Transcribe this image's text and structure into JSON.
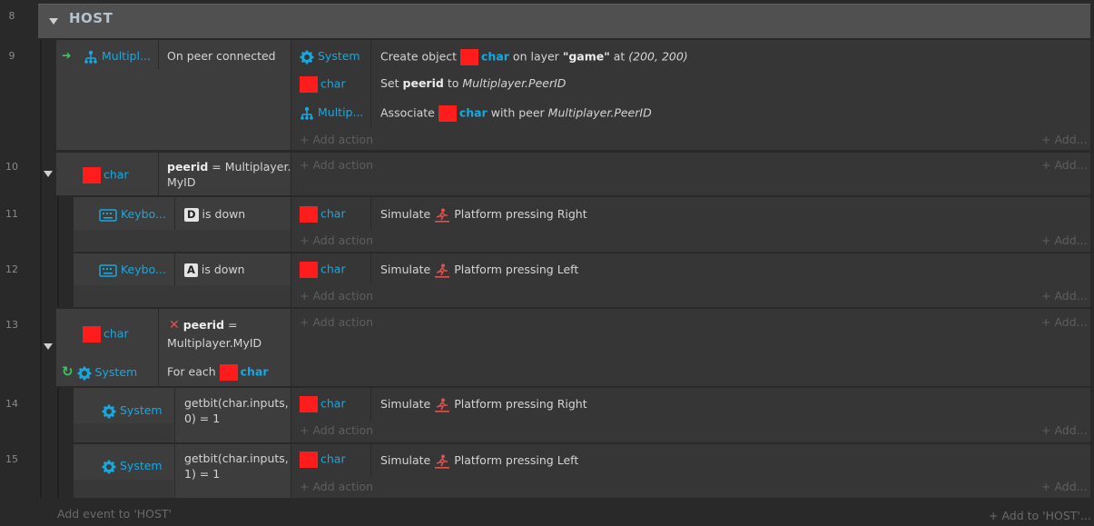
{
  "group": {
    "row": "8",
    "title": "HOST"
  },
  "events": [
    {
      "row": "9",
      "cond_object": "Multipl...",
      "cond_text": "On peer connected",
      "actions": [
        {
          "object": "System",
          "pre": "Create object",
          "obj": "char",
          "mid": "on layer",
          "bold": "\"game\"",
          "post": "at",
          "ital": "(200, 200)"
        },
        {
          "object": "char",
          "pre": "Set",
          "bold": "peerid",
          "mid": "to",
          "ital": "Multiplayer.PeerID"
        },
        {
          "object": "Multip...",
          "pre": "Associate",
          "obj": "char",
          "mid": "with peer",
          "ital": "Multiplayer.PeerID"
        }
      ]
    },
    {
      "row": "10",
      "cond_object": "char",
      "cond_bold": "peerid",
      "cond_text": "= Multiplayer.",
      "cond_text2": "MyID"
    },
    {
      "row": "11",
      "cond_object": "Keybo...",
      "key": "D",
      "cond_text": "is down",
      "actions": [
        {
          "object": "char",
          "pre": "Simulate",
          "post": "Platform pressing Right"
        }
      ]
    },
    {
      "row": "12",
      "cond_object": "Keybo...",
      "key": "A",
      "cond_text": "is down",
      "actions": [
        {
          "object": "char",
          "pre": "Simulate",
          "post": "Platform pressing Left"
        }
      ]
    },
    {
      "row": "13",
      "cond_object": "char",
      "cond_bold": "peerid",
      "cond_text": "=",
      "cond_text2": "Multiplayer.MyID",
      "cond2_object": "System",
      "cond2_text": "For each",
      "cond2_obj": "char"
    },
    {
      "row": "14",
      "cond_object": "System",
      "cond_text": "getbit(char.inputs,",
      "cond_text2": "0) = 1",
      "actions": [
        {
          "object": "char",
          "pre": "Simulate",
          "post": "Platform pressing Right"
        }
      ]
    },
    {
      "row": "15",
      "cond_object": "System",
      "cond_text": "getbit(char.inputs,",
      "cond_text2": "1) = 1",
      "actions": [
        {
          "object": "char",
          "pre": "Simulate",
          "post": "Platform pressing Left"
        }
      ]
    }
  ],
  "labels": {
    "add_action": "Add action",
    "add_more": "Add...",
    "add_event": "Add event to 'HOST'",
    "add_to": "Add to 'HOST'..."
  },
  "colors": {
    "object_blue": "#17a8e0",
    "object_red": "#ff1c1c",
    "invert_red": "#e05050",
    "loop_green": "#3cc65c"
  }
}
